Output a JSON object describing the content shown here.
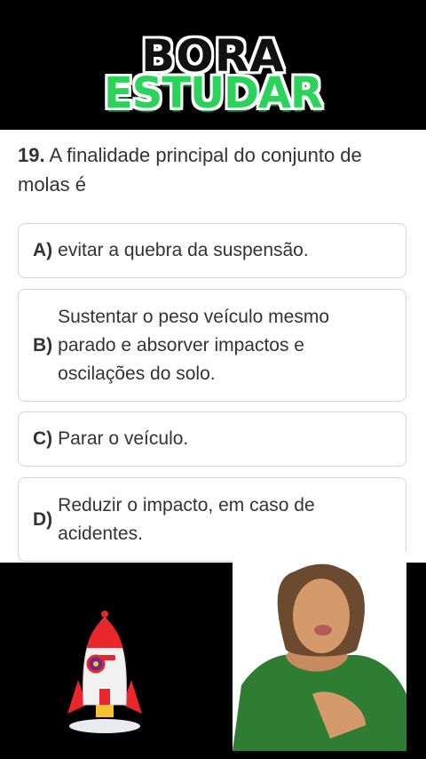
{
  "header": {
    "logo_line1": "BORA",
    "logo_line2": "ESTUDAR"
  },
  "question": {
    "number": "19.",
    "text": "A finalidade principal do conjunto de molas é"
  },
  "options": [
    {
      "letter": "A)",
      "text": "evitar a quebra da suspensão."
    },
    {
      "letter": "B)",
      "text": "Sustentar o peso veículo mesmo parado e absorver impactos e oscilações do solo."
    },
    {
      "letter": "C)",
      "text": "Parar o veículo."
    },
    {
      "letter": "D)",
      "text": "Reduzir o impacto, em caso de acidentes."
    }
  ],
  "colors": {
    "logo_green": "#2cd35a",
    "background": "#000000",
    "card": "#ffffff",
    "rocket_red": "#e8262b"
  },
  "icons": [
    "rocket-icon",
    "presenter-photo"
  ]
}
